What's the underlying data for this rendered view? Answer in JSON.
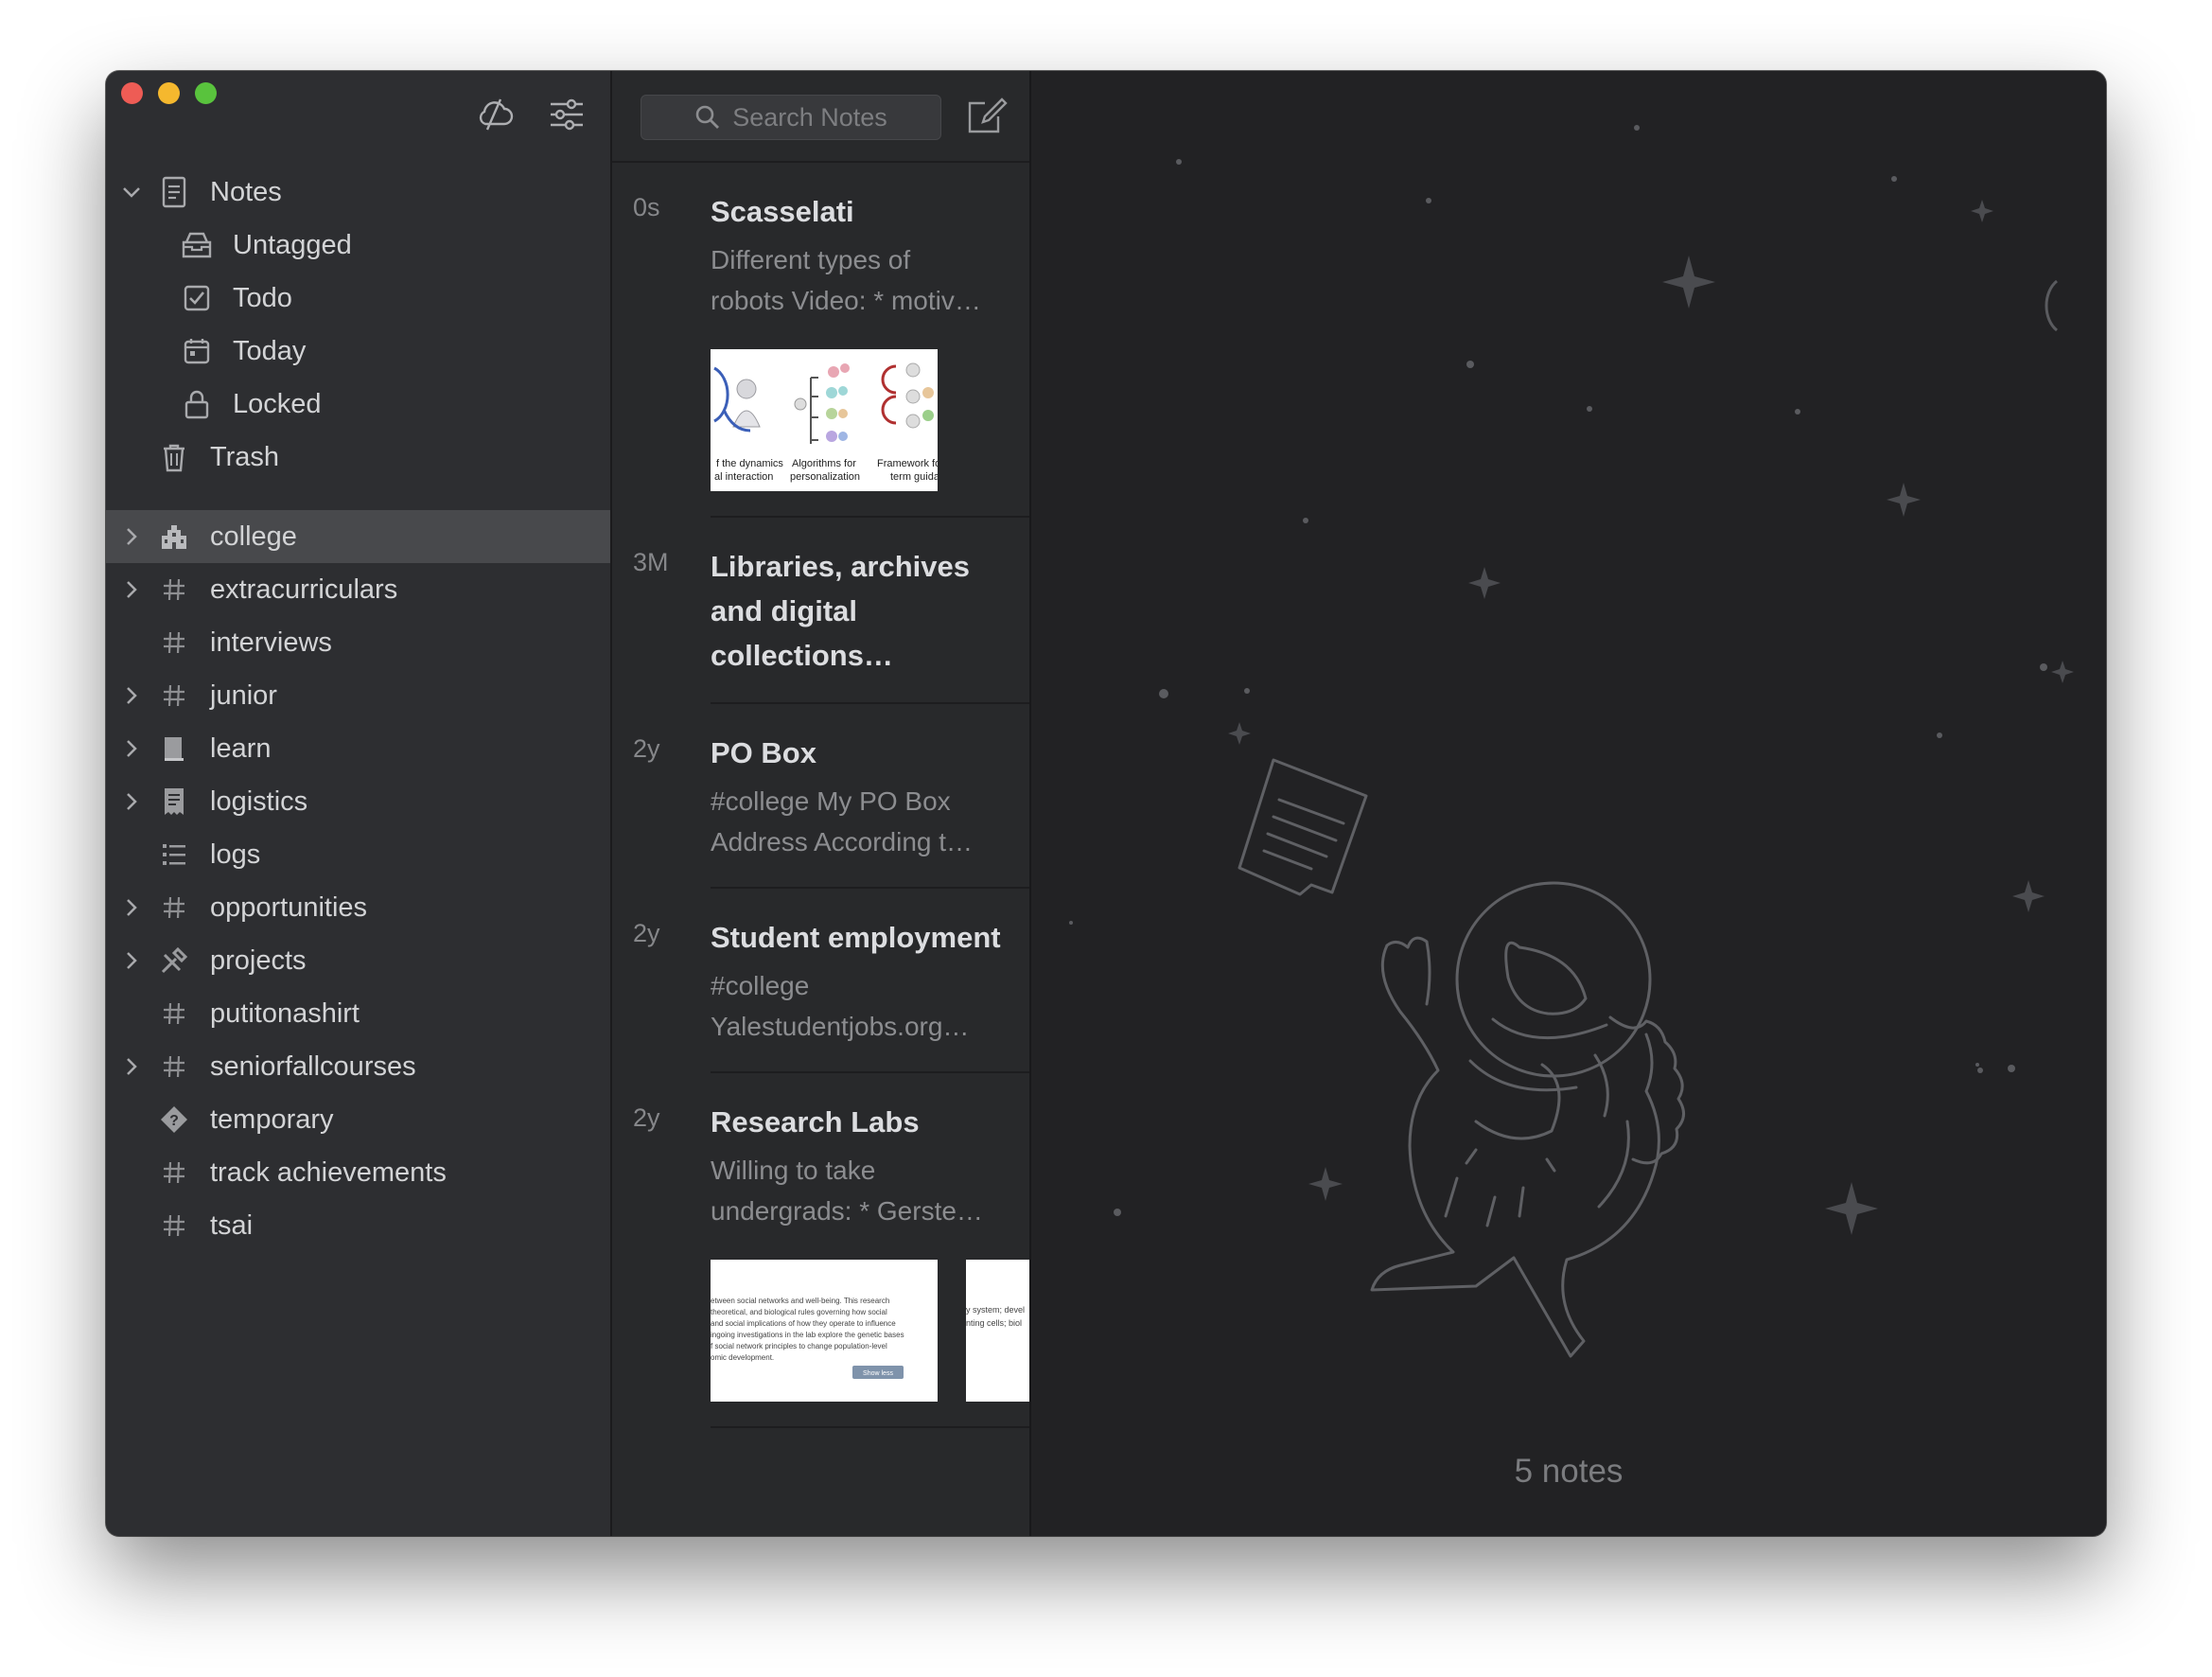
{
  "sidebar": {
    "top_items": [
      {
        "label": "Notes",
        "icon": "notes-icon",
        "expanded": true
      },
      {
        "label": "Untagged",
        "icon": "untagged-icon"
      },
      {
        "label": "Todo",
        "icon": "todo-checkbox-icon"
      },
      {
        "label": "Today",
        "icon": "calendar-icon"
      },
      {
        "label": "Locked",
        "icon": "lock-icon"
      },
      {
        "label": "Trash",
        "icon": "trash-icon"
      }
    ],
    "tags": [
      {
        "label": "college",
        "icon": "college-building-icon",
        "has_children": true,
        "selected": true
      },
      {
        "label": "extracurriculars",
        "icon": "hashtag-icon",
        "has_children": true
      },
      {
        "label": "interviews",
        "icon": "hashtag-icon",
        "has_children": false
      },
      {
        "label": "junior",
        "icon": "hashtag-icon",
        "has_children": true
      },
      {
        "label": "learn",
        "icon": "book-icon",
        "has_children": true
      },
      {
        "label": "logistics",
        "icon": "receipt-icon",
        "has_children": true
      },
      {
        "label": "logs",
        "icon": "list-icon",
        "has_children": false
      },
      {
        "label": "opportunities",
        "icon": "hashtag-icon",
        "has_children": true
      },
      {
        "label": "projects",
        "icon": "tools-icon",
        "has_children": true
      },
      {
        "label": "putitonashirt",
        "icon": "hashtag-icon",
        "has_children": false
      },
      {
        "label": "seniorfallcourses",
        "icon": "hashtag-icon",
        "has_children": true
      },
      {
        "label": "temporary",
        "icon": "question-diamond-icon",
        "has_children": false
      },
      {
        "label": "track achievements",
        "icon": "hashtag-icon",
        "has_children": false
      },
      {
        "label": "tsai",
        "icon": "hashtag-icon",
        "has_children": false
      }
    ]
  },
  "notes_list": {
    "search_placeholder": "Search Notes",
    "notes": [
      {
        "age": "0s",
        "title": "Scasselati",
        "preview_lines": [
          "Different types of",
          "robots Video: * motiv…"
        ]
      },
      {
        "age": "3M",
        "title_lines": [
          "Libraries, archives",
          "and digital",
          "collections…"
        ]
      },
      {
        "age": "2y",
        "title": "PO Box",
        "preview_lines": [
          "#college My PO Box",
          "Address According t…"
        ]
      },
      {
        "age": "2y",
        "title": "Student employment",
        "preview_lines": [
          "#college",
          "Yalestudentjobs.org…"
        ]
      },
      {
        "age": "2y",
        "title": "Research Labs",
        "preview_lines": [
          "Willing to take",
          "undergrads: * Gerste…"
        ]
      }
    ],
    "thumb1_captions": [
      "f the dynamics",
      "al interaction",
      "Algorithms for",
      "personalization",
      "Framework fo",
      "term guida"
    ],
    "thumb2_lines": [
      "etween social networks and well-being. This research",
      "theoretical, and biological rules governing how social",
      "and social implications of how they operate to influence",
      "ingoing investigations in the lab explore the genetic bases",
      "f social network principles to change population-level",
      "omic development."
    ],
    "thumb2_button": "Show less",
    "thumb3_lines": [
      "y system; devel",
      "nting cells; biol"
    ]
  },
  "main": {
    "count_text": "5 notes"
  },
  "colors": {
    "sidebar_bg": "#2d2e31",
    "selected_bg": "#48494c",
    "notes_bg": "#28292b",
    "main_bg": "#222224",
    "close": "#ee5c55",
    "minimize": "#f5b82e",
    "maximize": "#59c33d"
  }
}
